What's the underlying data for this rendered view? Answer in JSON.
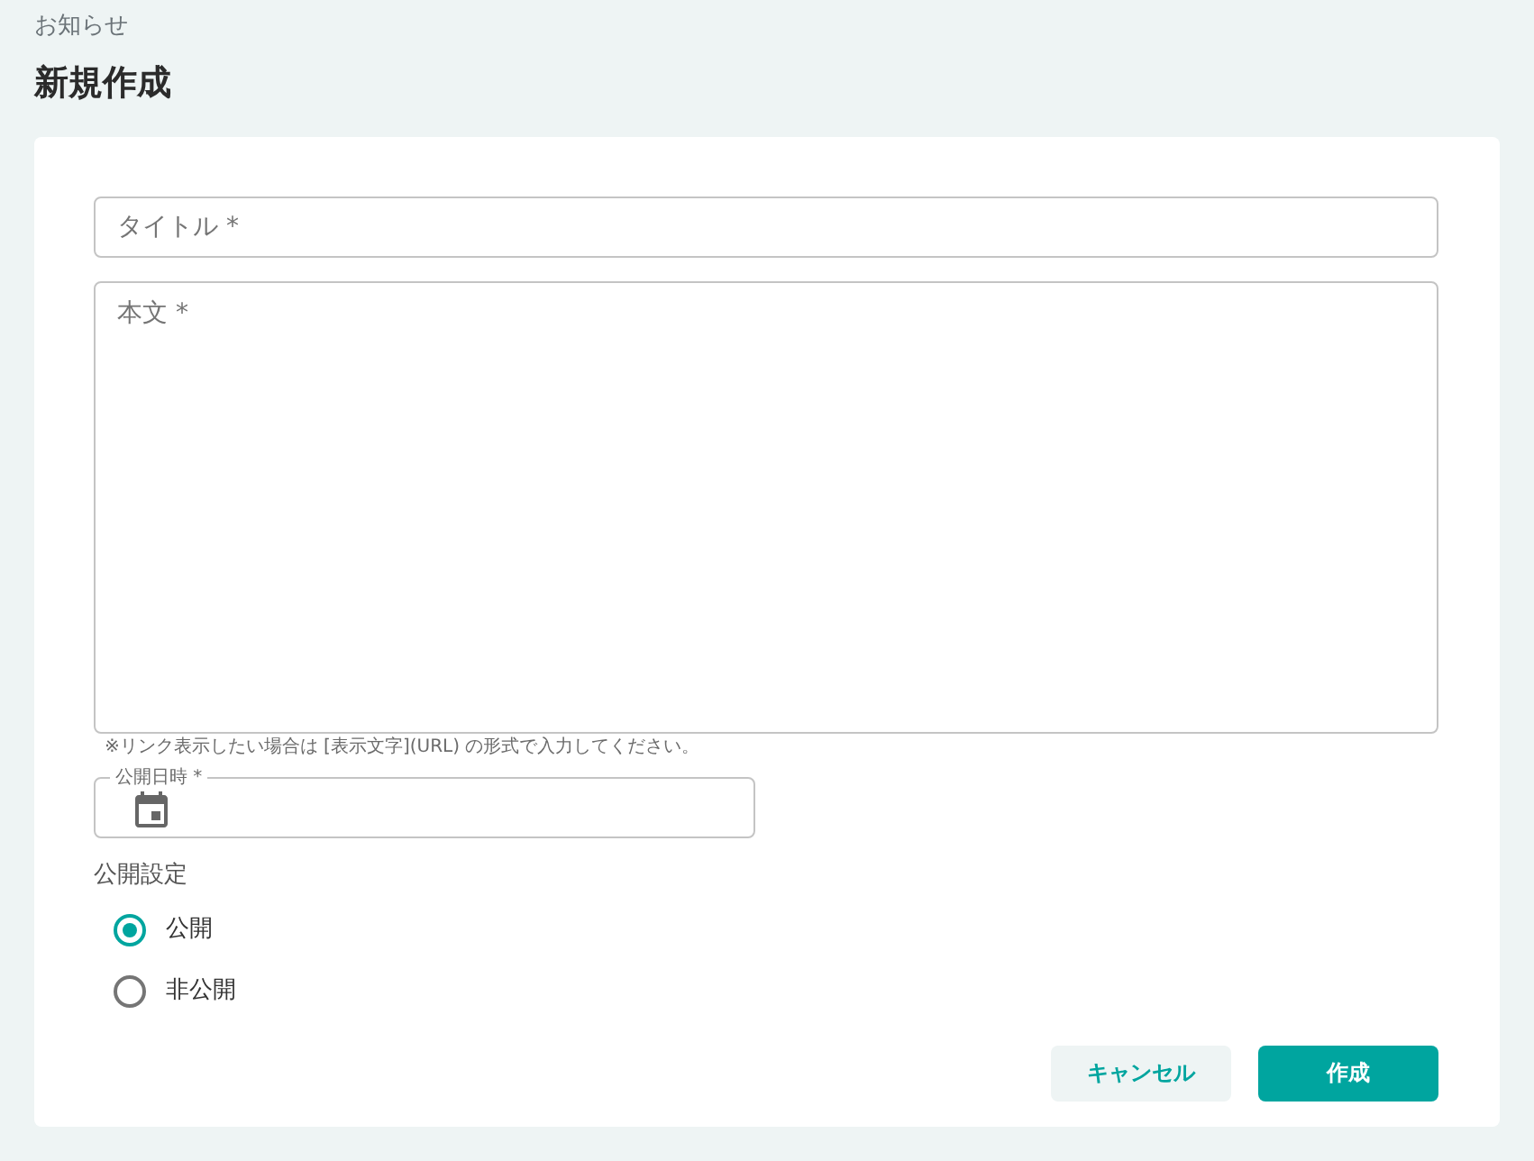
{
  "breadcrumb": "お知らせ",
  "page_title": "新規作成",
  "form": {
    "title_field": {
      "placeholder": "タイトル *"
    },
    "body_field": {
      "placeholder": "本文 *"
    },
    "body_hint": "※リンク表示したい場合は [表示文字](URL) の形式で入力してください。",
    "date_field": {
      "label": "公開日時 *"
    }
  },
  "visibility": {
    "label": "公開設定",
    "options": [
      {
        "label": "公開",
        "selected": true
      },
      {
        "label": "非公開",
        "selected": false
      }
    ]
  },
  "buttons": [
    {
      "label": "キャンセル",
      "kind": "secondary"
    },
    {
      "label": "作成",
      "kind": "primary"
    }
  ]
}
